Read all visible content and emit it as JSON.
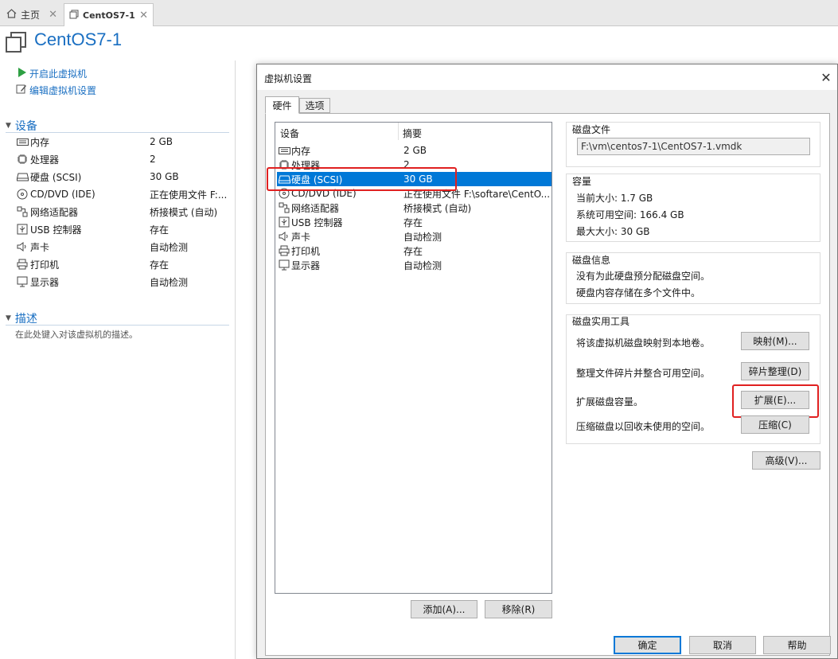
{
  "tabs": [
    {
      "label": "主页"
    },
    {
      "label": "CentOS7-1"
    }
  ],
  "vm": {
    "title": "CentOS7-1"
  },
  "actions": {
    "power_on": "开启此虚拟机",
    "edit_settings": "编辑虚拟机设置"
  },
  "devices_section": {
    "title": "设备",
    "items": [
      {
        "name": "内存",
        "summary": "2 GB"
      },
      {
        "name": "处理器",
        "summary": "2"
      },
      {
        "name": "硬盘 (SCSI)",
        "summary": "30 GB"
      },
      {
        "name": "CD/DVD (IDE)",
        "summary": "正在使用文件 F:..."
      },
      {
        "name": "网络适配器",
        "summary": "桥接模式 (自动)"
      },
      {
        "name": "USB 控制器",
        "summary": "存在"
      },
      {
        "name": "声卡",
        "summary": "自动检测"
      },
      {
        "name": "打印机",
        "summary": "存在"
      },
      {
        "name": "显示器",
        "summary": "自动检测"
      }
    ]
  },
  "description_section": {
    "title": "描述",
    "hint": "在此处键入对该虚拟机的描述。"
  },
  "dialog": {
    "title": "虚拟机设置",
    "close": "✕",
    "tabs": [
      {
        "label": "硬件"
      },
      {
        "label": "选项"
      }
    ],
    "list_headers": {
      "device": "设备",
      "summary": "摘要"
    },
    "list": [
      {
        "name": "内存",
        "summary": "2 GB"
      },
      {
        "name": "处理器",
        "summary": "2"
      },
      {
        "name": "硬盘 (SCSI)",
        "summary": "30 GB"
      },
      {
        "name": "CD/DVD (IDE)",
        "summary": "正在使用文件 F:\\softare\\CentO..."
      },
      {
        "name": "网络适配器",
        "summary": "桥接模式 (自动)"
      },
      {
        "name": "USB 控制器",
        "summary": "存在"
      },
      {
        "name": "声卡",
        "summary": "自动检测"
      },
      {
        "name": "打印机",
        "summary": "存在"
      },
      {
        "name": "显示器",
        "summary": "自动检测"
      }
    ],
    "add_button": "添加(A)...",
    "remove_button": "移除(R)",
    "disk_file": {
      "title": "磁盘文件",
      "path": "F:\\vm\\centos7-1\\CentOS7-1.vmdk"
    },
    "capacity": {
      "title": "容量",
      "current": "当前大小: 1.7 GB",
      "available": "系统可用空间: 166.4 GB",
      "max": "最大大小: 30 GB"
    },
    "disk_info": {
      "title": "磁盘信息",
      "line1": "没有为此硬盘预分配磁盘空间。",
      "line2": "硬盘内容存储在多个文件中。"
    },
    "utilities": {
      "title": "磁盘实用工具",
      "map_text": "将该虚拟机磁盘映射到本地卷。",
      "map_button": "映射(M)...",
      "defrag_text": "整理文件碎片并整合可用空间。",
      "defrag_button": "碎片整理(D)",
      "expand_text": "扩展磁盘容量。",
      "expand_button": "扩展(E)...",
      "compact_text": "压缩磁盘以回收未使用的空间。",
      "compact_button": "压缩(C)"
    },
    "advanced_button": "高级(V)...",
    "ok_button": "确定",
    "cancel_button": "取消",
    "help_button": "帮助"
  },
  "colors": {
    "accent": "#1a6fc2",
    "selection": "#0078d7",
    "highlight": "#e02020",
    "play": "#2ea043"
  }
}
